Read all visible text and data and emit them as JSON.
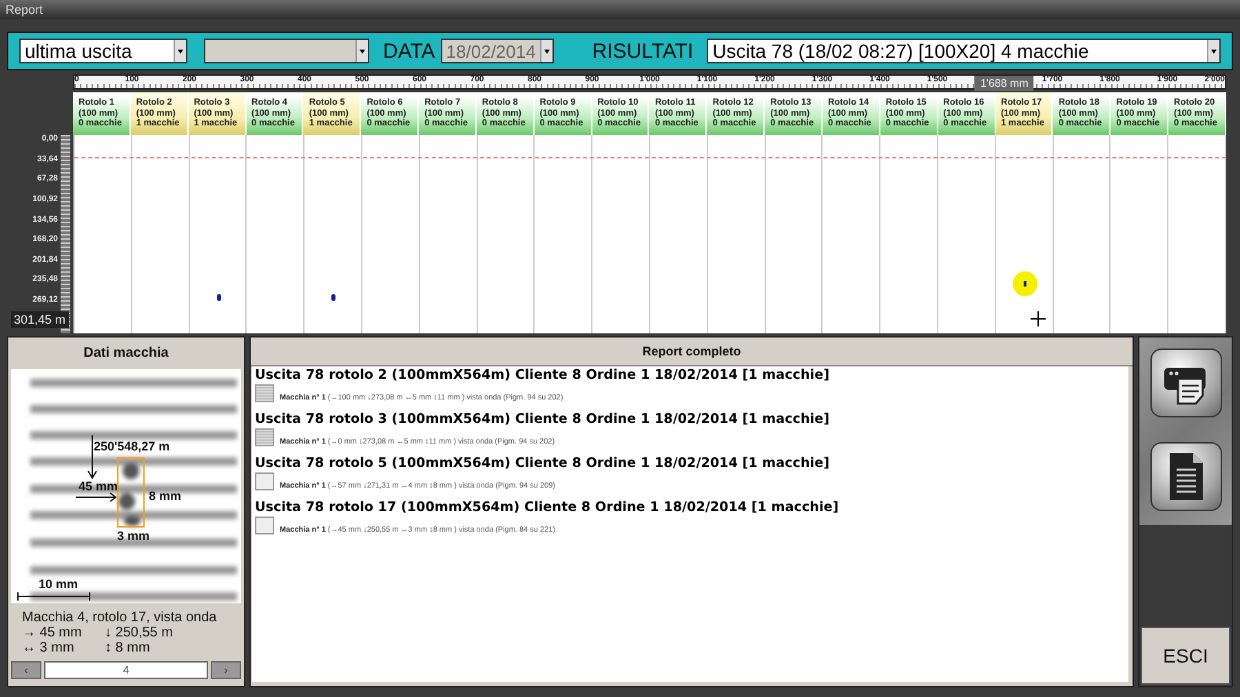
{
  "window": {
    "title": "Report"
  },
  "toolbar": {
    "mode_dropdown": {
      "value": "ultima uscita"
    },
    "second_dropdown": {
      "disabled": true
    },
    "date_label": "DATA",
    "date_field": {
      "value": "18/02/2014",
      "disabled": true
    },
    "results_label": "RISULTATI",
    "results_dropdown": {
      "value": "Uscita 78 (18/02 08:27) [100X20] 4 macchie"
    }
  },
  "ruler": {
    "labels_before_marker": [
      "0",
      "100",
      "200",
      "300",
      "400",
      "500",
      "600",
      "700",
      "800",
      "900",
      "1'000",
      "1'100",
      "1'200",
      "1'300",
      "1'400",
      "1'500"
    ],
    "marker": "1'688 mm",
    "labels_after_marker": [
      "1'700",
      "1'800",
      "1'900",
      "2'000"
    ]
  },
  "vertical_ruler": {
    "labels": [
      "0,00",
      "33,64",
      "67,28",
      "100,92",
      "134,56",
      "168,20",
      "201,84",
      "235,48",
      "269,12"
    ],
    "reading": "301,45 m"
  },
  "rolls": [
    {
      "name": "Rotolo 1",
      "width": "(100 mm)",
      "count": "0 macchie",
      "highlighted": false
    },
    {
      "name": "Rotolo 2",
      "width": "(100 mm)",
      "count": "1 macchie",
      "highlighted": true
    },
    {
      "name": "Rotolo 3",
      "width": "(100 mm)",
      "count": "1 macchie",
      "highlighted": true,
      "spot": {
        "selected": false
      }
    },
    {
      "name": "Rotolo 4",
      "width": "(100 mm)",
      "count": "0 macchie",
      "highlighted": false
    },
    {
      "name": "Rotolo 5",
      "width": "(100 mm)",
      "count": "1 macchie",
      "highlighted": true,
      "spot": {
        "selected": false
      }
    },
    {
      "name": "Rotolo 6",
      "width": "(100 mm)",
      "count": "0 macchie",
      "highlighted": false
    },
    {
      "name": "Rotolo 7",
      "width": "(100 mm)",
      "count": "0 macchie",
      "highlighted": false
    },
    {
      "name": "Rotolo 8",
      "width": "(100 mm)",
      "count": "0 macchie",
      "highlighted": false
    },
    {
      "name": "Rotolo 9",
      "width": "(100 mm)",
      "count": "0 macchie",
      "highlighted": false
    },
    {
      "name": "Rotolo 10",
      "width": "(100 mm)",
      "count": "0 macchie",
      "highlighted": false
    },
    {
      "name": "Rotolo 11",
      "width": "(100 mm)",
      "count": "0 macchie",
      "highlighted": false
    },
    {
      "name": "Rotolo 12",
      "width": "(100 mm)",
      "count": "0 macchie",
      "highlighted": false
    },
    {
      "name": "Rotolo 13",
      "width": "(100 mm)",
      "count": "0 macchie",
      "highlighted": false
    },
    {
      "name": "Rotolo 14",
      "width": "(100 mm)",
      "count": "0 macchie",
      "highlighted": false
    },
    {
      "name": "Rotolo 15",
      "width": "(100 mm)",
      "count": "0 macchie",
      "highlighted": false
    },
    {
      "name": "Rotolo 16",
      "width": "(100 mm)",
      "count": "0 macchie",
      "highlighted": false
    },
    {
      "name": "Rotolo 17",
      "width": "(100 mm)",
      "count": "1 macchie",
      "highlighted": true,
      "spot": {
        "selected": true
      }
    },
    {
      "name": "Rotolo 18",
      "width": "(100 mm)",
      "count": "0 macchie",
      "highlighted": false
    },
    {
      "name": "Rotolo 19",
      "width": "(100 mm)",
      "count": "0 macchie",
      "highlighted": false
    },
    {
      "name": "Rotolo 20",
      "width": "(100 mm)",
      "count": "0 macchie",
      "highlighted": false
    }
  ],
  "spot_panel": {
    "title": "Dati macchia",
    "image": {
      "position_label": "250'548,27 m",
      "x_label": "45 mm",
      "height_label": "8 mm",
      "width_label": "3 mm",
      "scale_label": "10 mm"
    },
    "info": {
      "title": "Macchia 4, rotolo 17, vista onda",
      "x": "→ 45 mm",
      "y": "↓  250,55 m",
      "w": "↔ 3 mm",
      "h": "↕  8 mm"
    },
    "nav": {
      "prev": "‹",
      "value": "4",
      "next": "›"
    }
  },
  "report": {
    "title": "Report completo",
    "entries": [
      {
        "title": "Uscita 78 rotolo 2 (100mmX564m) Cliente 8 Ordine 1 18/02/2014 [1 macchie]",
        "detail": "**Macchia n° 1** (→100 mm ↓273,08 m ↔5 mm ↕11 mm ) vista onda  (Pigm. 94 su 202)",
        "kind": "stripes"
      },
      {
        "title": "Uscita 78 rotolo 3 (100mmX564m) Cliente 8 Ordine 1 18/02/2014 [1 macchie]",
        "detail": "**Macchia n° 1** (→0 mm ↓273,08 m ↔5 mm ↕11 mm ) vista onda  (Pigm. 94 su 202)",
        "kind": "stripes"
      },
      {
        "title": "Uscita 78 rotolo 5 (100mmX564m) Cliente 8 Ordine 1 18/02/2014 [1 macchie]",
        "detail": "**Macchia n° 1** (→57 mm ↓271,31 m ↔4 mm ↕8 mm ) vista onda  (Pigm. 94 su 209)",
        "kind": "mark"
      },
      {
        "title": "Uscita 78 rotolo 17 (100mmX564m) Cliente 8 Ordine 1 18/02/2014 [1 macchie]",
        "detail": "**Macchia n° 1** (→45 mm ↓250,55 m ↔3 mm ↕8 mm ) vista onda  (Pigm. 84 su 221)",
        "kind": "mark"
      }
    ]
  },
  "actions": {
    "exit": "ESCI"
  }
}
